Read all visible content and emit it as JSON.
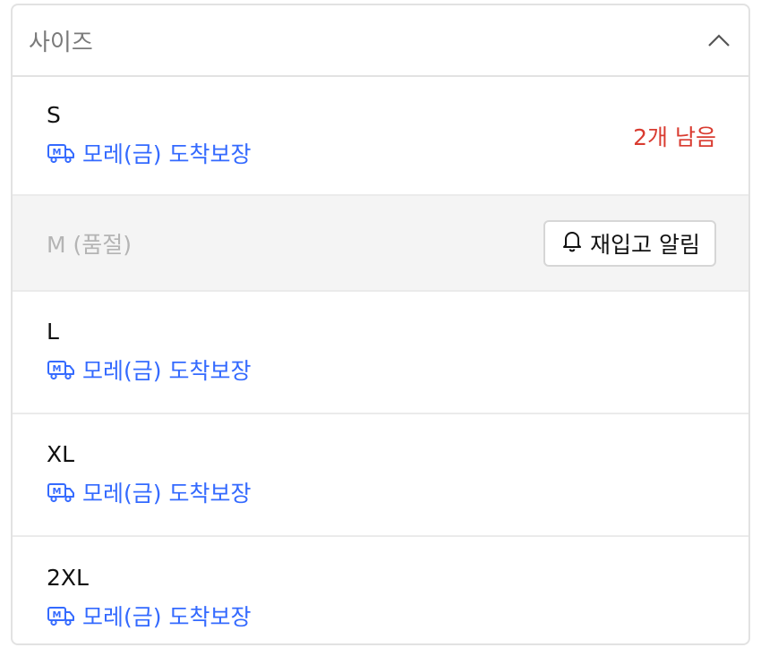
{
  "dropdown": {
    "title": "사이즈",
    "expanded": true
  },
  "options": {
    "s": {
      "size": "S",
      "delivery": "모레(금) 도착보장",
      "stock": "2개 남음"
    },
    "m": {
      "label": "M (품절)",
      "notify_button": "재입고 알림"
    },
    "l": {
      "size": "L",
      "delivery": "모레(금) 도착보장"
    },
    "xl": {
      "size": "XL",
      "delivery": "모레(금) 도착보장"
    },
    "xxl": {
      "size": "2XL",
      "delivery": "모레(금) 도착보장"
    }
  },
  "colors": {
    "accent": "#346aff",
    "stock_warning": "#d93b30",
    "muted": "#b4b4b4",
    "soldout_bg": "#f4f4f4"
  },
  "icons": {
    "delivery": "rocket-truck-icon",
    "toggle": "chevron-up-icon",
    "notify": "bell-icon"
  }
}
